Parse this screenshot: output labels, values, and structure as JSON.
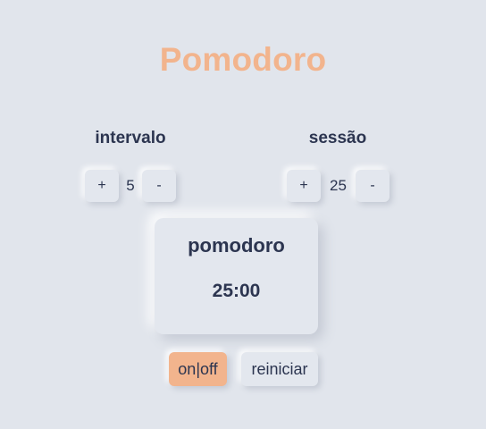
{
  "app": {
    "title": "Pomodoro"
  },
  "intervalo": {
    "label": "intervalo",
    "plus_label": "+",
    "value": "5",
    "minus_label": "-"
  },
  "sessao": {
    "label": "sessão",
    "plus_label": "+",
    "value": "25",
    "minus_label": "-"
  },
  "timer": {
    "mode": "pomodoro",
    "time": "25:00"
  },
  "controls": {
    "onoff_label": "on|off",
    "reset_label": "reiniciar"
  },
  "colors": {
    "background": "#e1e5ec",
    "accent": "#f2b48d",
    "text": "#2c3550"
  }
}
